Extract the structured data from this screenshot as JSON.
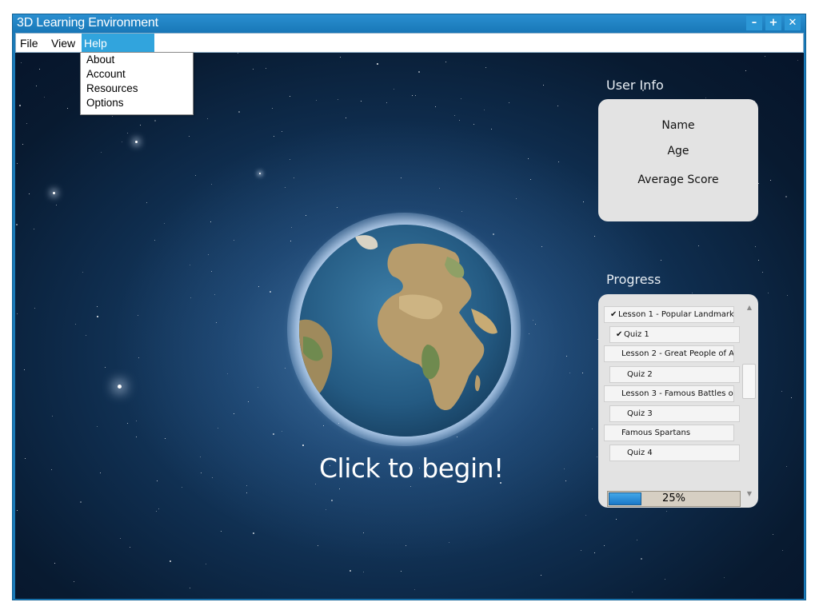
{
  "window": {
    "title": "3D Learning Environment",
    "minimize": "–",
    "maximize": "+",
    "close": "✕"
  },
  "menubar": {
    "file": "File",
    "view": "View",
    "help": "Help"
  },
  "help_menu": {
    "items": [
      "About",
      "Account",
      "Resources",
      "Options"
    ]
  },
  "scene": {
    "cta": "Click to begin!"
  },
  "user_info": {
    "title": "User Info",
    "fields": [
      "Name",
      "Age",
      "Average Score"
    ]
  },
  "progress": {
    "title": "Progress",
    "items": [
      {
        "label": "Lesson 1 - Popular Landmark...",
        "completed": true
      },
      {
        "label": "Quiz 1",
        "completed": true
      },
      {
        "label": "Lesson 2 - Great People of A...",
        "completed": false
      },
      {
        "label": "Quiz 2",
        "completed": false
      },
      {
        "label": "Lesson 3 - Famous Battles o...",
        "completed": false
      },
      {
        "label": "Quiz 3",
        "completed": false
      },
      {
        "label": "Famous Spartans",
        "completed": false
      },
      {
        "label": "Quiz 4",
        "completed": false
      }
    ],
    "check_glyph": "✔",
    "percent": 25,
    "percent_label": "25%"
  },
  "icons": [
    "minimize-icon",
    "maximize-icon",
    "close-icon",
    "check-icon",
    "scroll-up-icon",
    "scroll-down-icon",
    "globe"
  ],
  "colors": {
    "titlebar": "#1877b7",
    "menu_highlight": "#31a4dd",
    "progress_fill": "#2f8fd8",
    "panel_bg": "#e3e3e3"
  }
}
